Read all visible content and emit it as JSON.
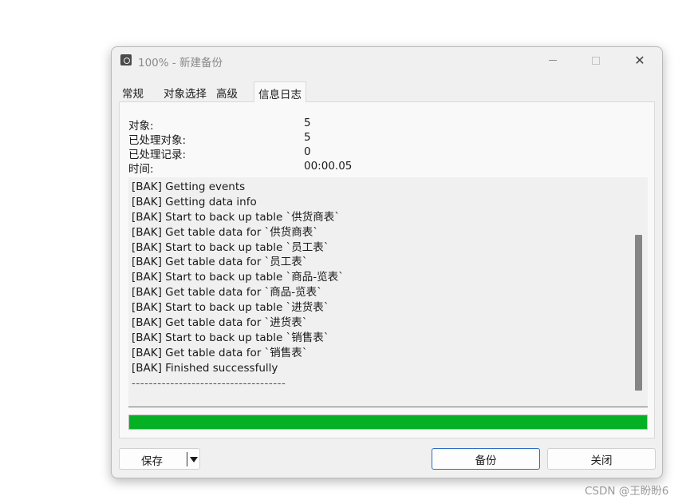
{
  "window": {
    "title": "100% - 新建备份",
    "close_glyph": "✕"
  },
  "tabs": [
    {
      "label": "常规"
    },
    {
      "label": "对象选择"
    },
    {
      "label": "高级"
    },
    {
      "label": "信息日志",
      "active": true
    }
  ],
  "stats": [
    {
      "label": "对象:",
      "value": "5"
    },
    {
      "label": "已处理对象:",
      "value": "5"
    },
    {
      "label": "已处理记录:",
      "value": "0"
    },
    {
      "label": "时间:",
      "value": "00:00.05"
    }
  ],
  "log": {
    "lines": [
      "[BAK] Getting events",
      "[BAK] Getting data info",
      "[BAK] Start to back up table `供货商表`",
      "[BAK] Get table data for `供货商表`",
      "[BAK] Start to back up table `员工表`",
      "[BAK] Get table data for `员工表`",
      "[BAK] Start to back up table `商品-览表`",
      "[BAK] Get table data for `商品-览表`",
      "[BAK] Start to back up table `进货表`",
      "[BAK] Get table data for `进货表`",
      "[BAK] Start to back up table `销售表`",
      "[BAK] Get table data for `销售表`",
      "[BAK] Finished successfully"
    ],
    "separator": "------------------------------------"
  },
  "progress": {
    "percent": 100,
    "color": "#06b025"
  },
  "buttons": {
    "save_label": "保存",
    "backup_label": "备份",
    "close_label": "关闭"
  },
  "watermark": "CSDN @王盼盼6"
}
